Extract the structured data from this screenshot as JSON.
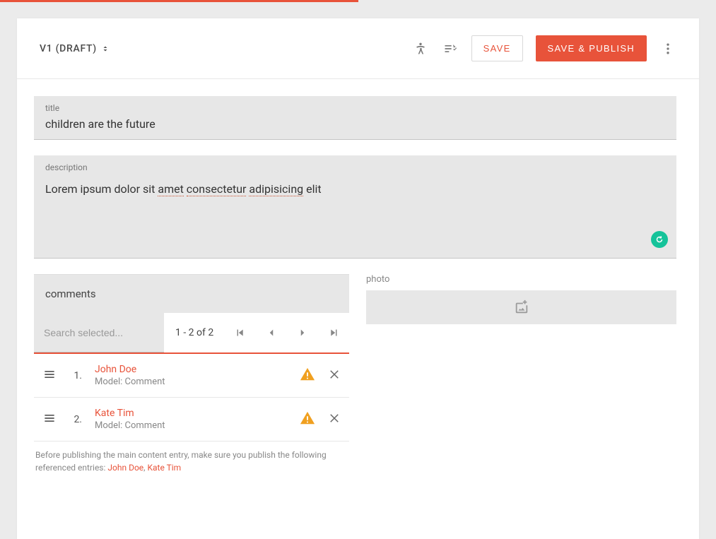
{
  "header": {
    "version_label": "V1 (DRAFT)",
    "save_label": "SAVE",
    "publish_label": "SAVE & PUBLISH"
  },
  "fields": {
    "title": {
      "label": "title",
      "value": "children are the future"
    },
    "description": {
      "label": "description",
      "text_prefix": "Lorem ipsum dolor sit ",
      "spell1": "amet",
      "spell2": "consectetur",
      "spell3": "adipisicing",
      "text_suffix": " elit"
    }
  },
  "comments": {
    "header_label": "comments",
    "search_placeholder": "Search selected...",
    "pagination": "1 - 2 of 2",
    "rows": [
      {
        "index": "1.",
        "name": "John Doe",
        "model": "Model: Comment"
      },
      {
        "index": "2.",
        "name": "Kate Tim",
        "model": "Model: Comment"
      }
    ],
    "warning": {
      "prefix": "Before publishing the main content entry, make sure you publish the following referenced entries: ",
      "link1": "John Doe",
      "sep": ", ",
      "link2": "Kate Tim"
    }
  },
  "photo": {
    "label": "photo"
  }
}
